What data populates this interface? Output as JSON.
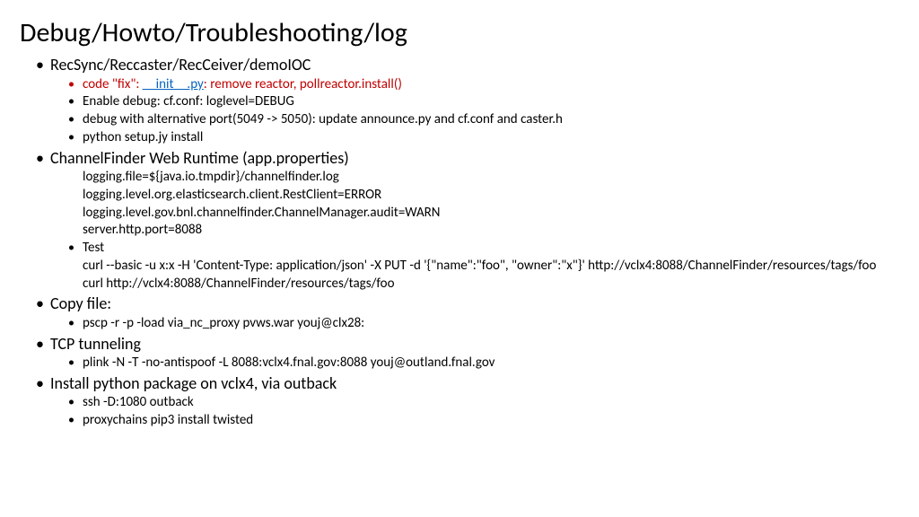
{
  "title": "Debug/Howto/Troubleshooting/log",
  "sections": [
    {
      "heading": "RecSync/Reccaster/RecCeiver/demoIOC",
      "items": [
        {
          "red": true,
          "pre": "code \"fix\": ",
          "link": "__init__.py",
          "post": ": remove reactor, pollreactor.install()"
        },
        {
          "text": "Enable debug: cf.conf: loglevel=DEBUG"
        },
        {
          "text": "debug with alternative port(5049 -> 5050): update announce.py and cf.conf and caster.h"
        },
        {
          "text": "python setup.jy install"
        }
      ]
    },
    {
      "heading": "ChannelFinder Web Runtime (app.properties)",
      "items": [
        {
          "nobullet": true,
          "text": "logging.file=${java.io.tmpdir}/channelfinder.log"
        },
        {
          "nobullet": true,
          "text": "logging.level.org.elasticsearch.client.RestClient=ERROR"
        },
        {
          "nobullet": true,
          "text": "logging.level.gov.bnl.channelfinder.ChannelManager.audit=WARN"
        },
        {
          "nobullet": true,
          "text": "server.http.port=8088"
        },
        {
          "text": "Test"
        },
        {
          "nobullet": true,
          "text": "curl --basic -u x:x -H 'Content-Type: application/json'  -X PUT -d '{\"name\":\"foo\", \"owner\":\"x\"}' http://vclx4:8088/ChannelFinder/resources/tags/foo"
        },
        {
          "nobullet": true,
          "text": "curl http://vclx4:8088/ChannelFinder/resources/tags/foo"
        }
      ]
    },
    {
      "heading": "Copy file:",
      "items": [
        {
          "text": "pscp -r -p -load via_nc_proxy pvws.war youj@clx28:"
        }
      ]
    },
    {
      "heading": "TCP tunneling",
      "items": [
        {
          "text": "plink -N -T -no-antispoof -L 8088:vclx4.fnal.gov:8088 youj@outland.fnal.gov"
        }
      ]
    },
    {
      "heading": "Install python package on vclx4, via outback",
      "items": [
        {
          "text": "ssh -D:1080 outback"
        },
        {
          "text": "proxychains pip3 install twisted"
        }
      ]
    }
  ]
}
